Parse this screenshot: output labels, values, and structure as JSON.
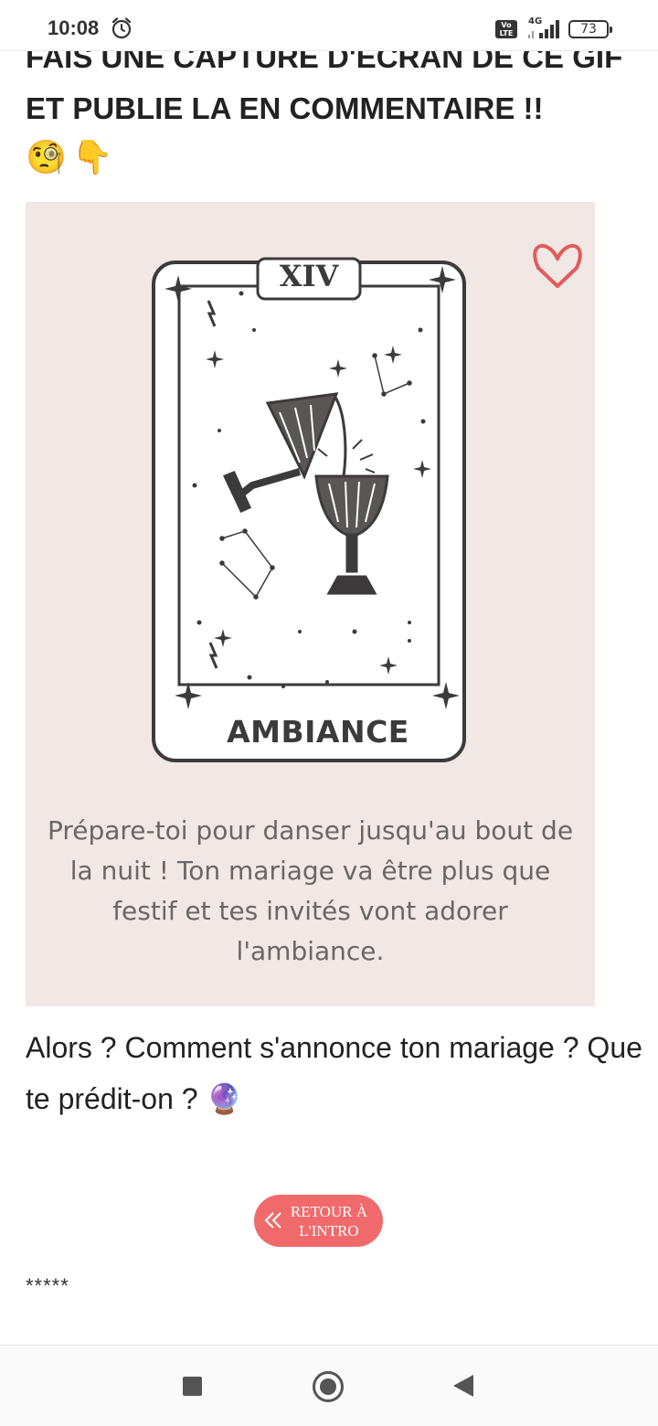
{
  "status_bar": {
    "time": "10:08",
    "alarm_icon": "alarm-clock-icon",
    "volte": "Vo LTE",
    "network": "4G",
    "battery": "73"
  },
  "article": {
    "heading": "FAIS UNE CAPTURE D'ECRAN DE CE GIF ET PUBLIE LA EN COMMENTAIRE !!",
    "emojis": [
      "🧐",
      "👇"
    ],
    "card": {
      "numeral": "XIV",
      "title": "AMBIANCE",
      "caption": "Prépare-toi pour danser jusqu'au bout de la nuit ! Ton mariage va être plus que festif et tes invités vont adorer l'ambiance.",
      "heart_icon": "heart-outline-icon",
      "accent_color": "#e25b5b",
      "background_color": "#f1e8e6"
    },
    "question": "Alors ? Comment s'annonce ton mariage ? Que te prédit-on ? 🔮",
    "back_button": {
      "label_line1": "RETOUR À",
      "label_line2": "L'INTRO",
      "color": "#f06a6b"
    },
    "separator": "*****"
  },
  "nav_bar": {
    "recents_icon": "square-recents-icon",
    "home_icon": "circle-home-icon",
    "back_icon": "triangle-back-icon"
  }
}
